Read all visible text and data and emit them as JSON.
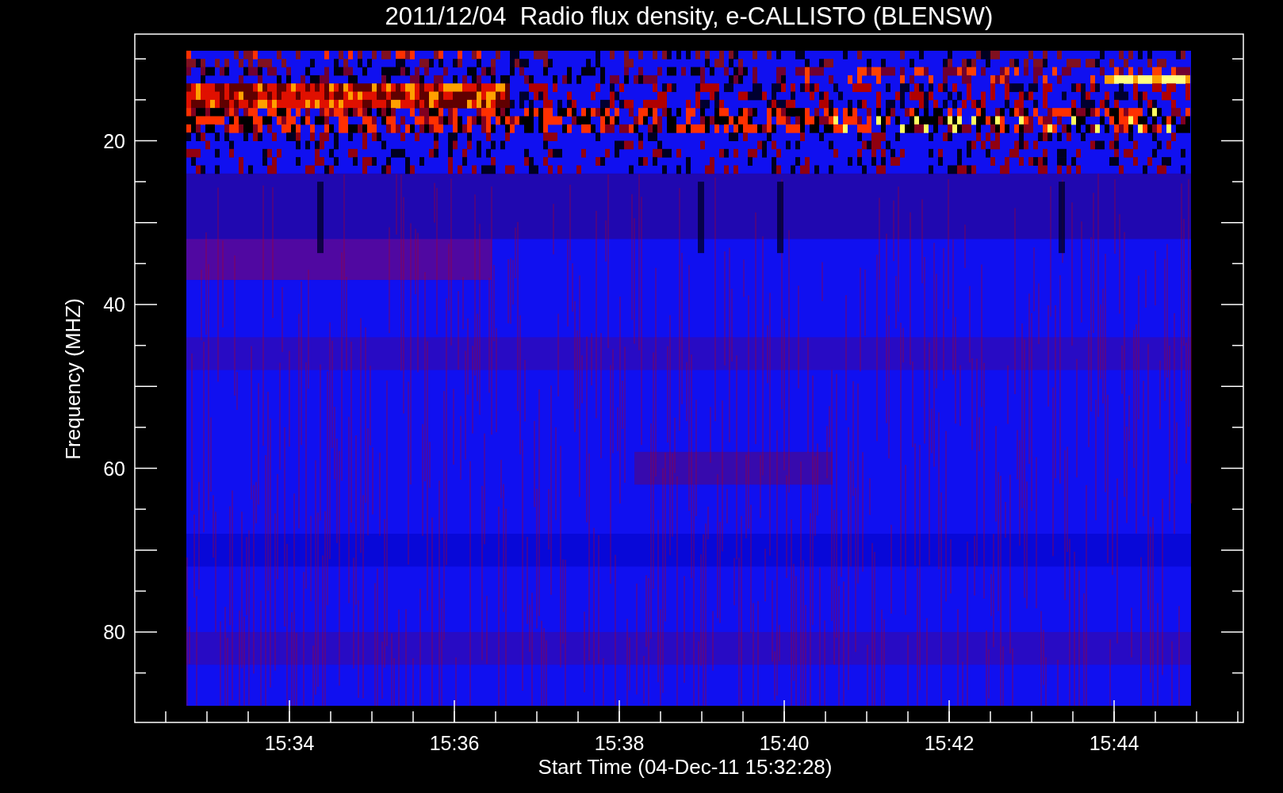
{
  "title": "2011/12/04  Radio flux density, e-CALLISTO (BLENSW)",
  "y_axis": {
    "label": "Frequency (MHZ)",
    "ticks": [
      "20",
      "40",
      "60",
      "80"
    ]
  },
  "x_axis": {
    "label": "Start Time (04-Dec-11 15:32:28)",
    "ticks": [
      "15:34",
      "15:36",
      "15:38",
      "15:40",
      "15:42",
      "15:44"
    ]
  }
}
